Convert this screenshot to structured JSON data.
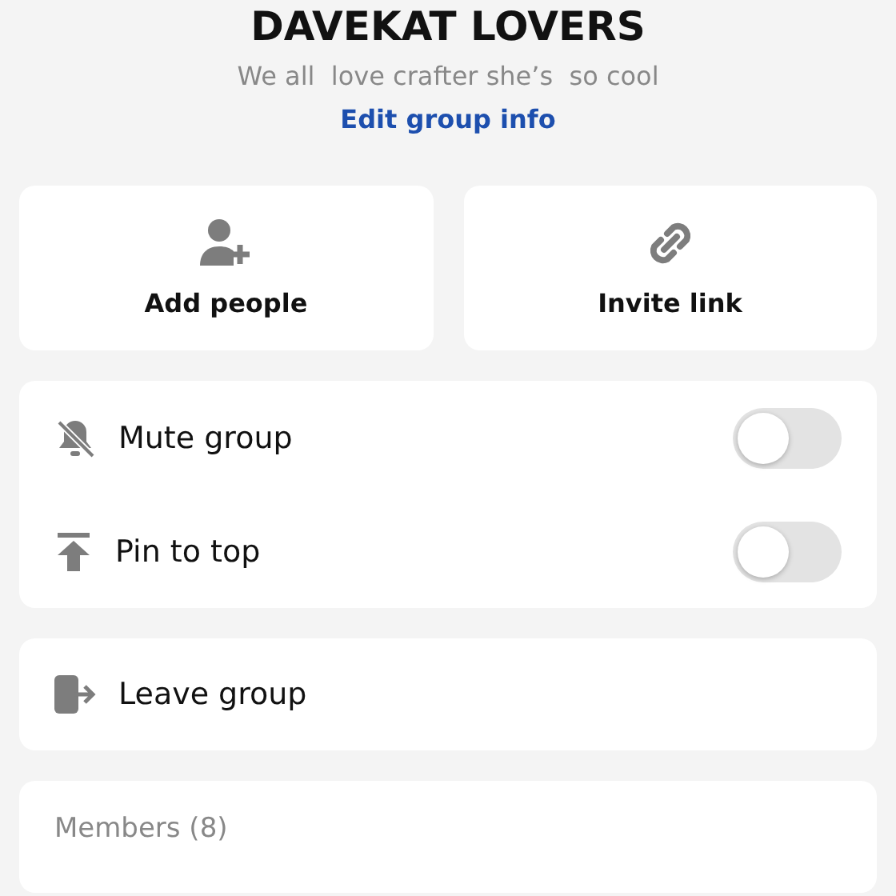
{
  "group": {
    "name": "DAVEKAT LOVERS",
    "description": "We all  love crafter she’s  so cool",
    "edit_link": "Edit group info"
  },
  "actions": [
    {
      "kind": "add",
      "label": "Add people"
    },
    {
      "kind": "link",
      "label": "Invite link"
    }
  ],
  "settings": [
    {
      "kind": "mute",
      "label": "Mute group",
      "on": false
    },
    {
      "kind": "pin",
      "label": "Pin to top",
      "on": false
    }
  ],
  "leave": {
    "label": "Leave group"
  },
  "members": {
    "heading": "Members (8)"
  }
}
